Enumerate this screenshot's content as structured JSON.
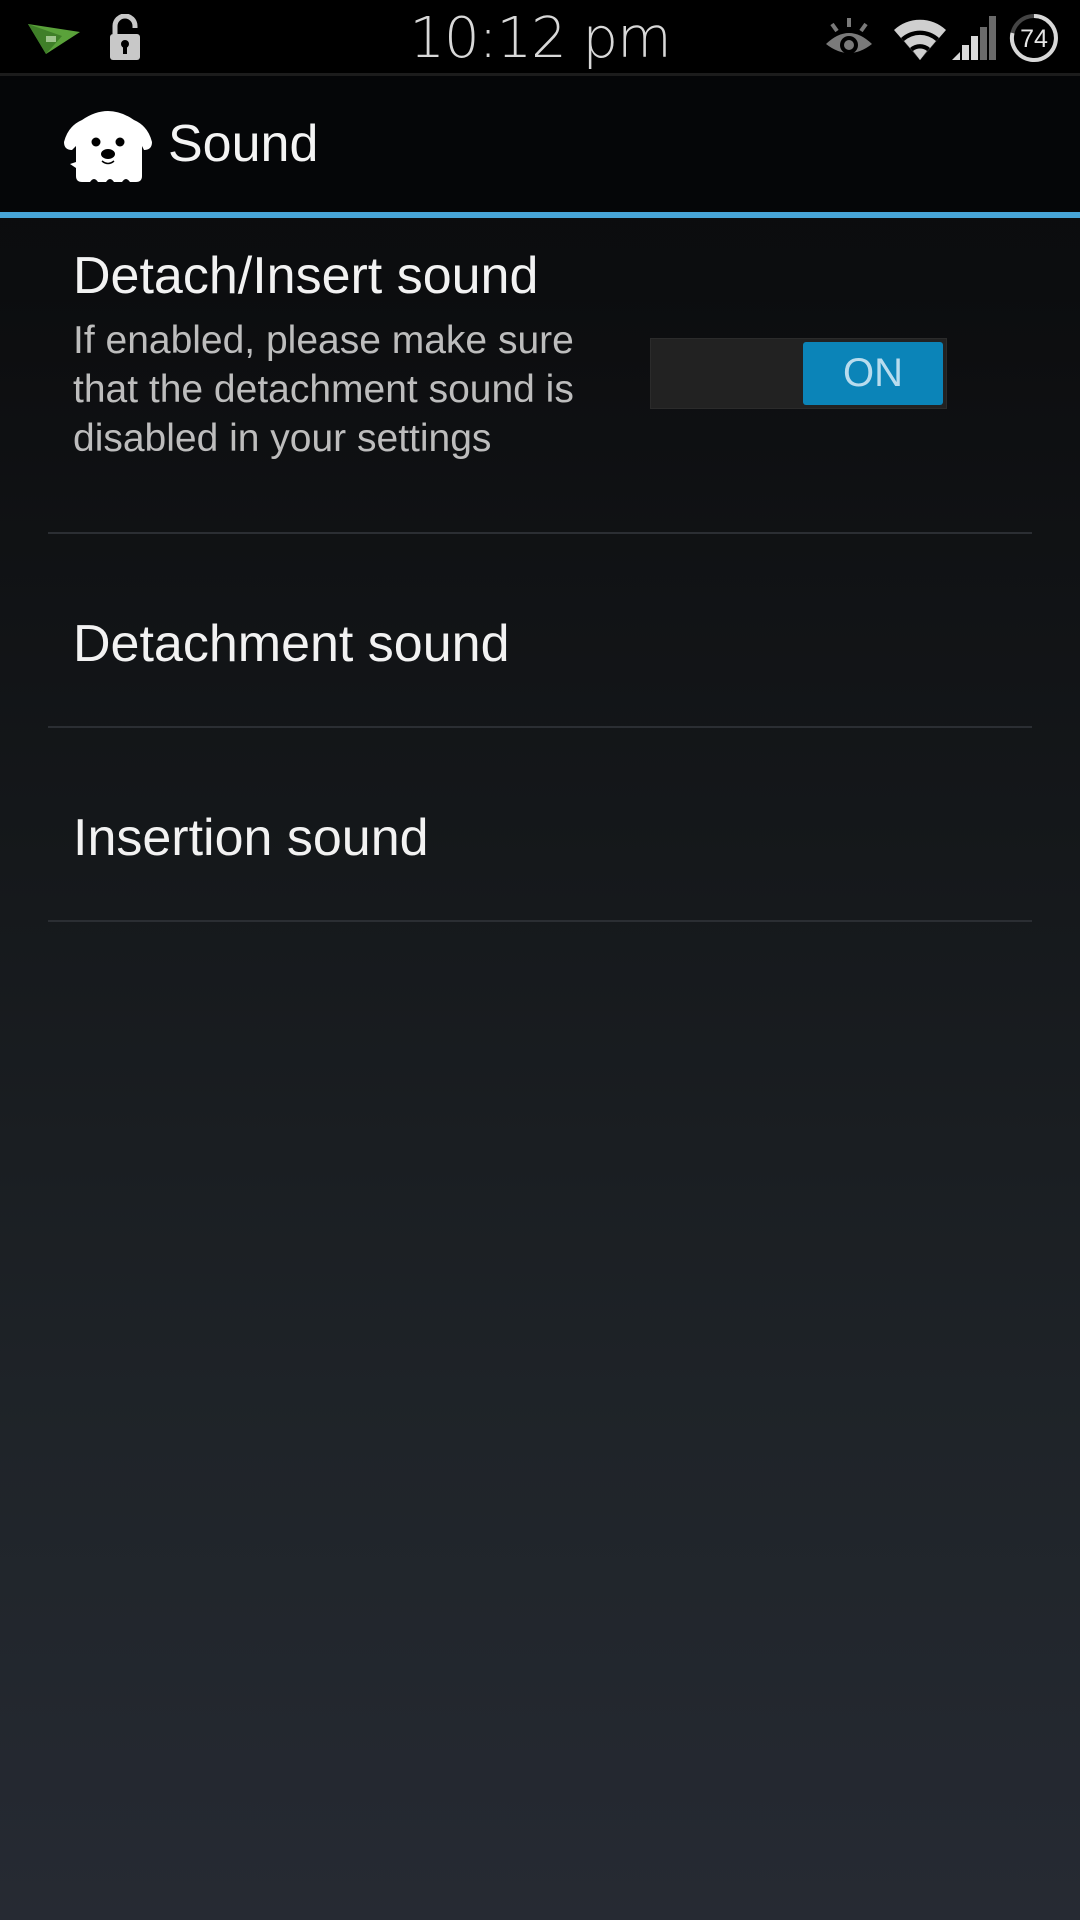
{
  "status_bar": {
    "time": "10:12 pm",
    "battery_percent": 74,
    "battery_label": "74",
    "icons": [
      "airdroid-icon",
      "unlocked-padlock-icon",
      "eye-icon",
      "wifi-icon",
      "cell-signal-icon",
      "battery-circle-icon"
    ],
    "wifi_strength": "full",
    "signal_bars_filled": 3,
    "signal_bars_total": 5
  },
  "action_bar": {
    "app_icon": "dog-icon",
    "title": "Sound"
  },
  "colors": {
    "accent": "#47a4d6",
    "toggle_on": "#0b84b8",
    "airdroid_green": "#5aa23a"
  },
  "preferences": [
    {
      "title": "Detach/Insert sound",
      "summary": "If enabled, please make sure that the detachment sound is disabled in your settings",
      "toggle": {
        "state": "on",
        "label": "ON"
      }
    },
    {
      "title": "Detachment sound"
    },
    {
      "title": "Insertion sound"
    }
  ]
}
